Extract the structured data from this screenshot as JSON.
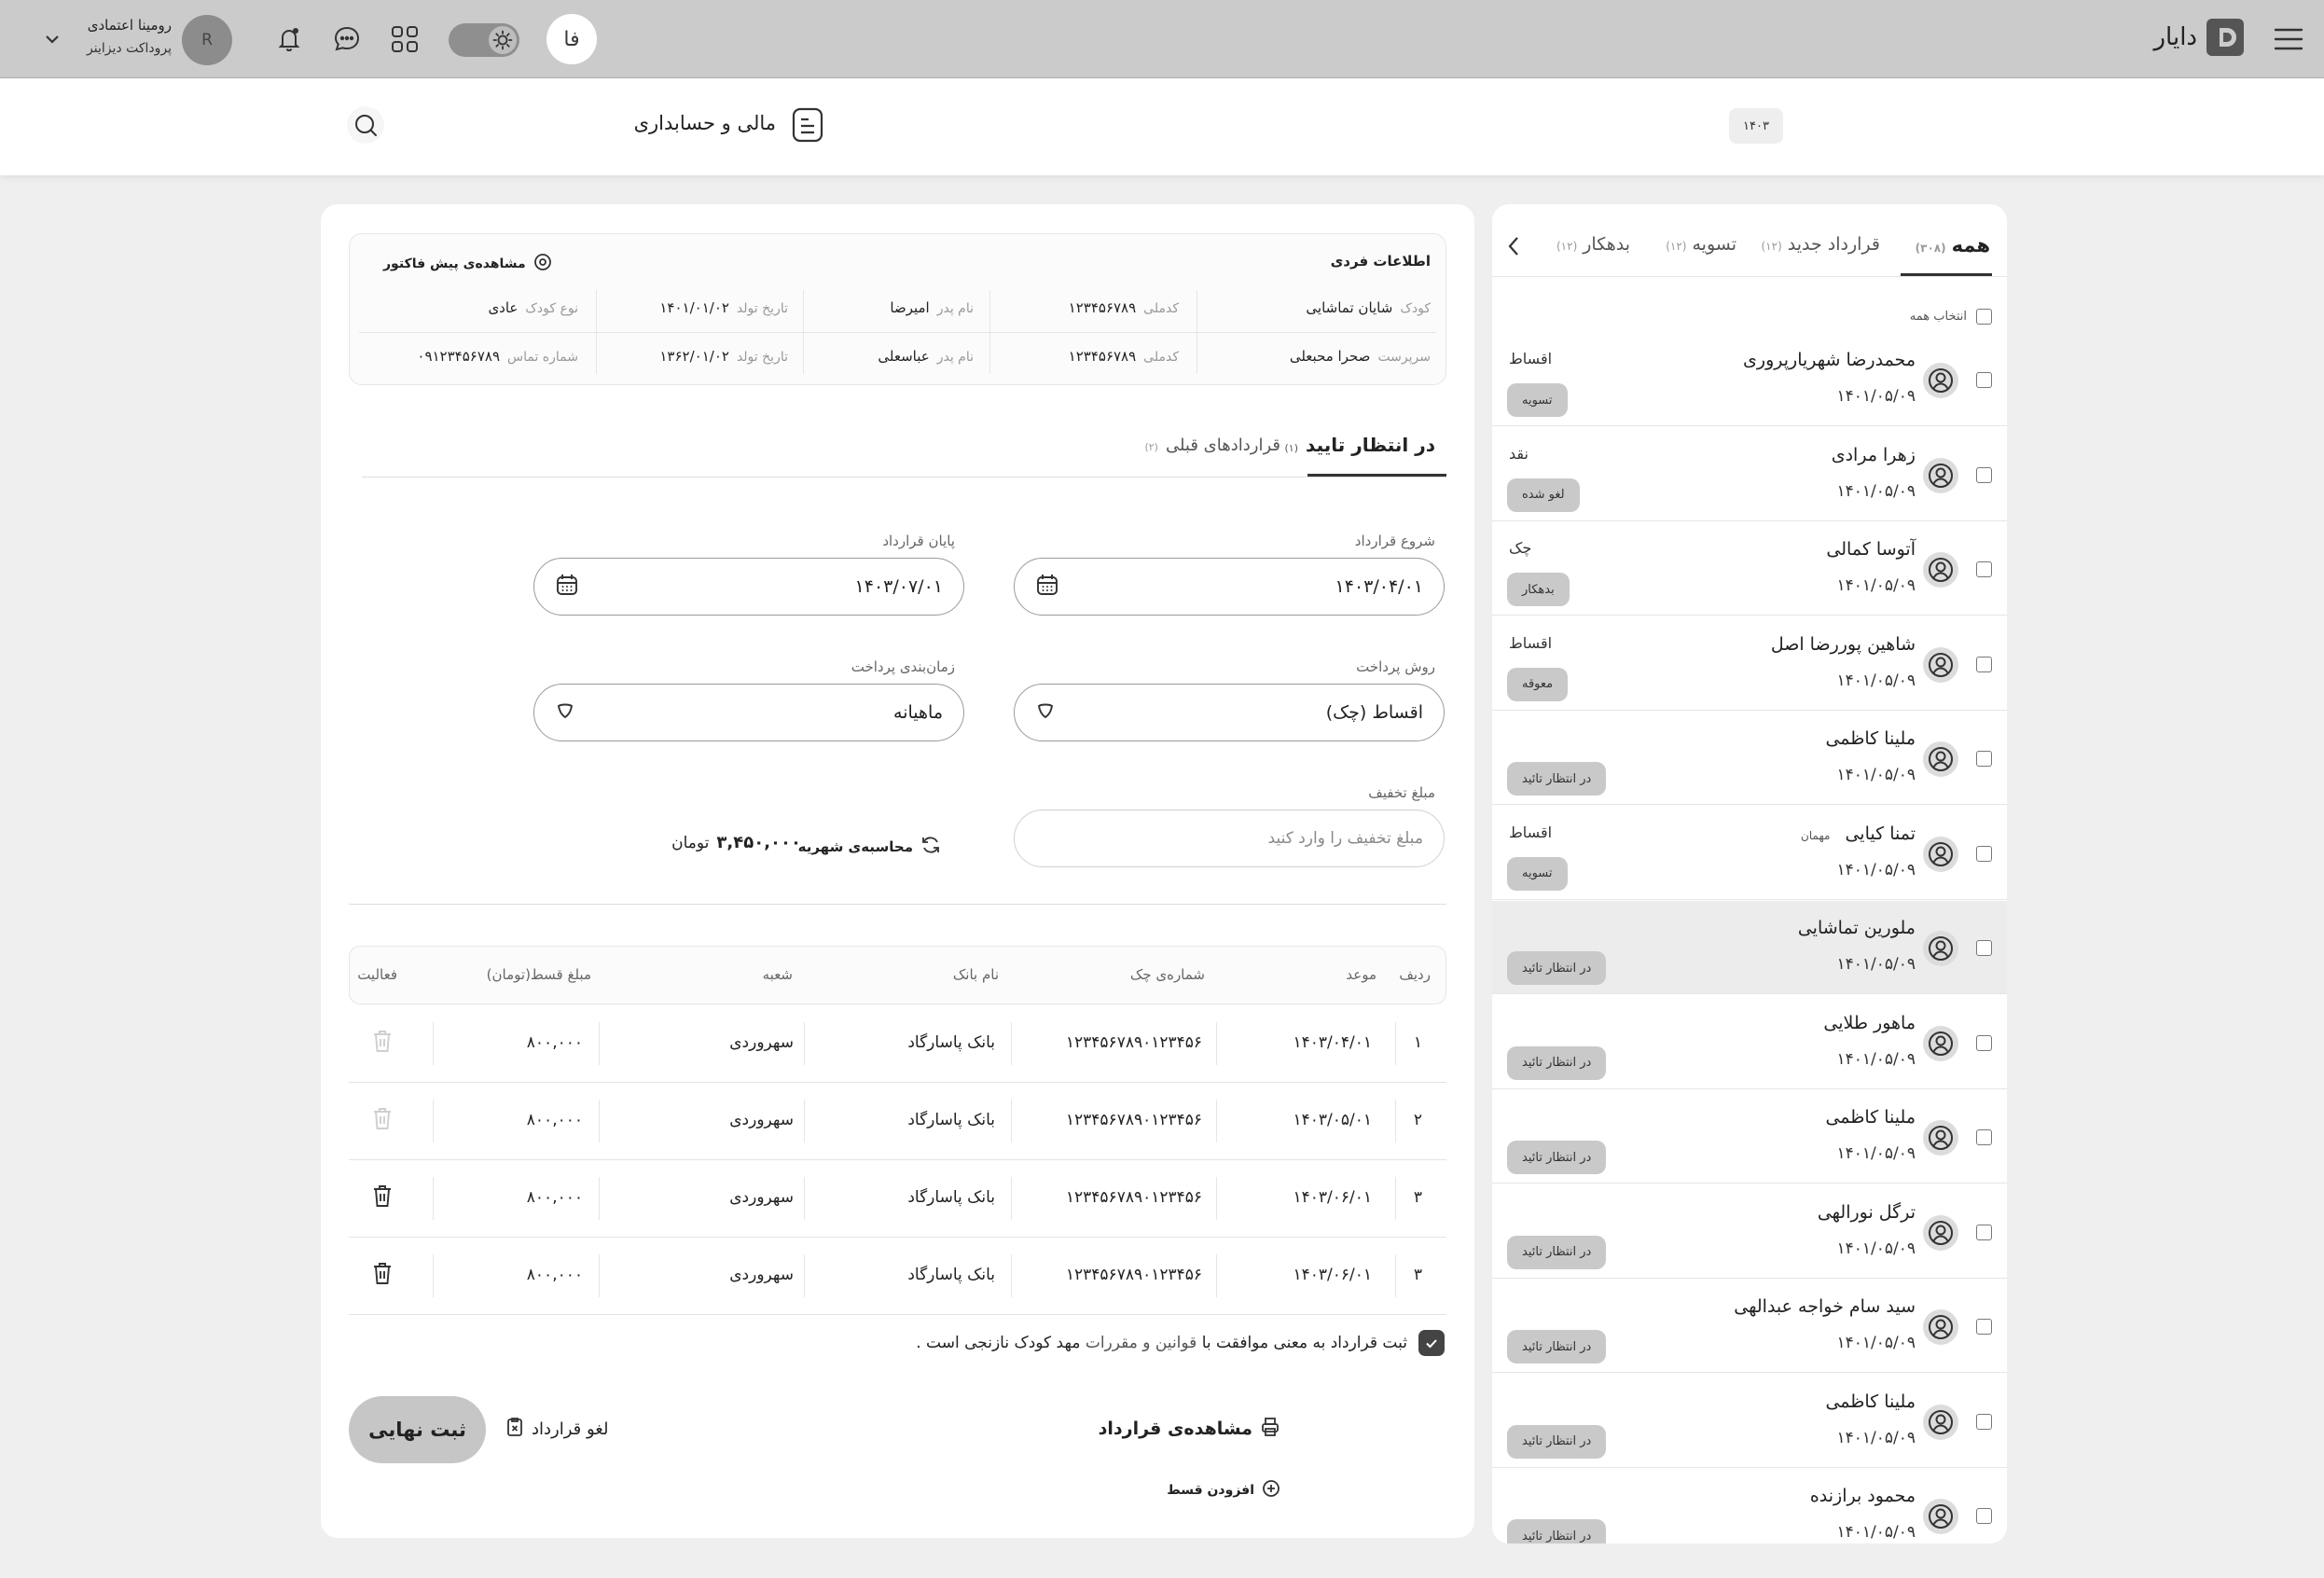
{
  "header": {
    "logo_text": "دایار",
    "lang_button": "فا",
    "user_name": "رومینا اعتمادی",
    "user_role": "پروداکت دیزاینر",
    "avatar_initial": "R"
  },
  "subheader": {
    "section_title": "مالی و حسابداری",
    "year_badge": "۱۴۰۳"
  },
  "sidebar": {
    "tabs": [
      {
        "label": "همه",
        "count": "(۳۰۸)"
      },
      {
        "label": "قرارداد جدید",
        "count": "(۱۲)"
      },
      {
        "label": "تسویه",
        "count": "(۱۲)"
      },
      {
        "label": "بدهکار",
        "count": "(۱۲)"
      }
    ],
    "select_all": "انتخاب همه",
    "items": [
      {
        "name": "محمدرضا شهریارپروری",
        "date": "۱۴۰۱/۰۵/۰۹",
        "type": "اقساط",
        "status": "تسویه",
        "guest": ""
      },
      {
        "name": "زهرا مرادی",
        "date": "۱۴۰۱/۰۵/۰۹",
        "type": "نقد",
        "status": "لغو شده",
        "guest": ""
      },
      {
        "name": "آتوسا کمالی",
        "date": "۱۴۰۱/۰۵/۰۹",
        "type": "چک",
        "status": "بدهکار",
        "guest": ""
      },
      {
        "name": "شاهین پوررضا اصل",
        "date": "۱۴۰۱/۰۵/۰۹",
        "type": "اقساط",
        "status": "معوقه",
        "guest": ""
      },
      {
        "name": "ملینا کاظمی",
        "date": "۱۴۰۱/۰۵/۰۹",
        "type": "",
        "status": "در انتظار تائید",
        "guest": ""
      },
      {
        "name": "تمنا کیایی",
        "date": "۱۴۰۱/۰۵/۰۹",
        "type": "اقساط",
        "status": "تسویه",
        "guest": "مهمان"
      },
      {
        "name": "ملورین تماشایی",
        "date": "۱۴۰۱/۰۵/۰۹",
        "type": "",
        "status": "در انتظار تائید",
        "guest": ""
      },
      {
        "name": "ماهور طلایی",
        "date": "۱۴۰۱/۰۵/۰۹",
        "type": "",
        "status": "در انتظار تائید",
        "guest": ""
      },
      {
        "name": "ملینا کاظمی",
        "date": "۱۴۰۱/۰۵/۰۹",
        "type": "",
        "status": "در انتظار تائید",
        "guest": ""
      },
      {
        "name": "ترگل نورالهی",
        "date": "۱۴۰۱/۰۵/۰۹",
        "type": "",
        "status": "در انتظار تائید",
        "guest": ""
      },
      {
        "name": "سید سام خواجه عبدالهی",
        "date": "۱۴۰۱/۰۵/۰۹",
        "type": "",
        "status": "در انتظار تائید",
        "guest": ""
      },
      {
        "name": "ملینا کاظمی",
        "date": "۱۴۰۱/۰۵/۰۹",
        "type": "",
        "status": "در انتظار تائید",
        "guest": ""
      },
      {
        "name": "محمود برازنده",
        "date": "۱۴۰۱/۰۵/۰۹",
        "type": "",
        "status": "در انتظار تائید",
        "guest": ""
      }
    ]
  },
  "info": {
    "title": "اطلاعات فردی",
    "invoice_link": "مشاهده‌ی پیش فاکتور",
    "child": {
      "label": "کودک",
      "name": "شایان تماشایی",
      "id_label": "کدملی",
      "id": "۱۲۳۴۵۶۷۸۹",
      "father_label": "نام پدر",
      "father": "امیرضا",
      "birth_label": "تاریخ تولد",
      "birth": "۱۴۰۱/۰۱/۰۲",
      "type_label": "نوع کودک",
      "type": "عادی"
    },
    "guardian": {
      "label": "سرپرست",
      "name": "صحرا محبعلی",
      "id_label": "کدملی",
      "id": "۱۲۳۴۵۶۷۸۹",
      "father_label": "نام پدر",
      "father": "عباسعلی",
      "birth_label": "تاریخ تولد",
      "birth": "۱۳۶۲/۰۱/۰۲",
      "phone_label": "شماره تماس",
      "phone": "۰۹۱۲۳۴۵۶۷۸۹"
    }
  },
  "contract_tabs": [
    {
      "label": "در انتظار تایید",
      "count": "(۱)"
    },
    {
      "label": "قراردادهای قبلی",
      "count": "(۲)"
    }
  ],
  "form": {
    "start_label": "شروع قرارداد",
    "start_value": "۱۴۰۳/۰۴/۰۱",
    "end_label": "پایان قرارداد",
    "end_value": "۱۴۰۳/۰۷/۰۱",
    "method_label": "روش پرداخت",
    "method_value": "اقساط (چک)",
    "schedule_label": "زمان‌بندی پرداخت",
    "schedule_value": "ماهیانه",
    "discount_label": "مبلغ تخفیف",
    "discount_placeholder": "مبلغ تخفیف را وارد کنید",
    "calc_label": "محاسبه‌ی شهریه",
    "total_amount": "۳,۴۵۰,۰۰۰",
    "currency": "تومان"
  },
  "table": {
    "headers": [
      "ردیف",
      "موعد",
      "شماره‌ی چک",
      "نام بانک",
      "شعبه",
      "مبلغ قسط(تومان)",
      "فعالیت"
    ],
    "rows": [
      {
        "idx": "۱",
        "due": "۱۴۰۳/۰۴/۰۱",
        "check": "۱۲۳۴۵۶۷۸۹۰۱۲۳۴۵۶",
        "bank": "بانک پاسارگاد",
        "branch": "سهروردی",
        "amount": "۸۰۰,۰۰۰",
        "deletable": false
      },
      {
        "idx": "۲",
        "due": "۱۴۰۳/۰۵/۰۱",
        "check": "۱۲۳۴۵۶۷۸۹۰۱۲۳۴۵۶",
        "bank": "بانک پاسارگاد",
        "branch": "سهروردی",
        "amount": "۸۰۰,۰۰۰",
        "deletable": false
      },
      {
        "idx": "۳",
        "due": "۱۴۰۳/۰۶/۰۱",
        "check": "۱۲۳۴۵۶۷۸۹۰۱۲۳۴۵۶",
        "bank": "بانک پاسارگاد",
        "branch": "سهروردی",
        "amount": "۸۰۰,۰۰۰",
        "deletable": true
      },
      {
        "idx": "۳",
        "due": "۱۴۰۳/۰۶/۰۱",
        "check": "۱۲۳۴۵۶۷۸۹۰۱۲۳۴۵۶",
        "bank": "بانک پاسارگاد",
        "branch": "سهروردی",
        "amount": "۸۰۰,۰۰۰",
        "deletable": true
      }
    ]
  },
  "agreement": {
    "text_a": "ثبت قرارداد به معنی موافقت با",
    "text_link": "قوانین و مقررات",
    "text_b": "مهد کودک نازنجی است ."
  },
  "actions": {
    "view_contract": "مشاهده‌ی قرارداد",
    "add_installment": "افزودن قسط",
    "cancel_contract": "لغو قرارداد",
    "final_submit": "ثبت نهایی"
  }
}
